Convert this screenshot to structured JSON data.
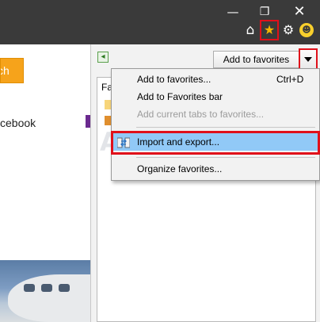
{
  "window": {
    "minimize_glyph": "—",
    "restore_glyph": "❐",
    "close_glyph": "✕"
  },
  "toolbar": {
    "home_icon": "home-icon",
    "favorites_icon": "star-icon",
    "settings_icon": "gear-icon",
    "feedback_icon": "smiley-icon"
  },
  "page": {
    "search_button_text": "ch",
    "facebook_link": "cebook"
  },
  "favorites_pane": {
    "add_button_label": "Add to favorites",
    "list_header": "Fa"
  },
  "menu": {
    "items": [
      {
        "label": "Add to favorites...",
        "shortcut": "Ctrl+D",
        "enabled": true
      },
      {
        "label": "Add to Favorites bar",
        "enabled": true
      },
      {
        "label": "Add current tabs to favorites...",
        "enabled": false
      },
      {
        "label": "Import and export...",
        "enabled": true,
        "highlighted": true
      },
      {
        "label": "Organize favorites...",
        "enabled": true
      }
    ]
  },
  "colors": {
    "highlight_border": "#e0101a",
    "selection": "#91c9f7",
    "search_button": "#f6a31b"
  }
}
